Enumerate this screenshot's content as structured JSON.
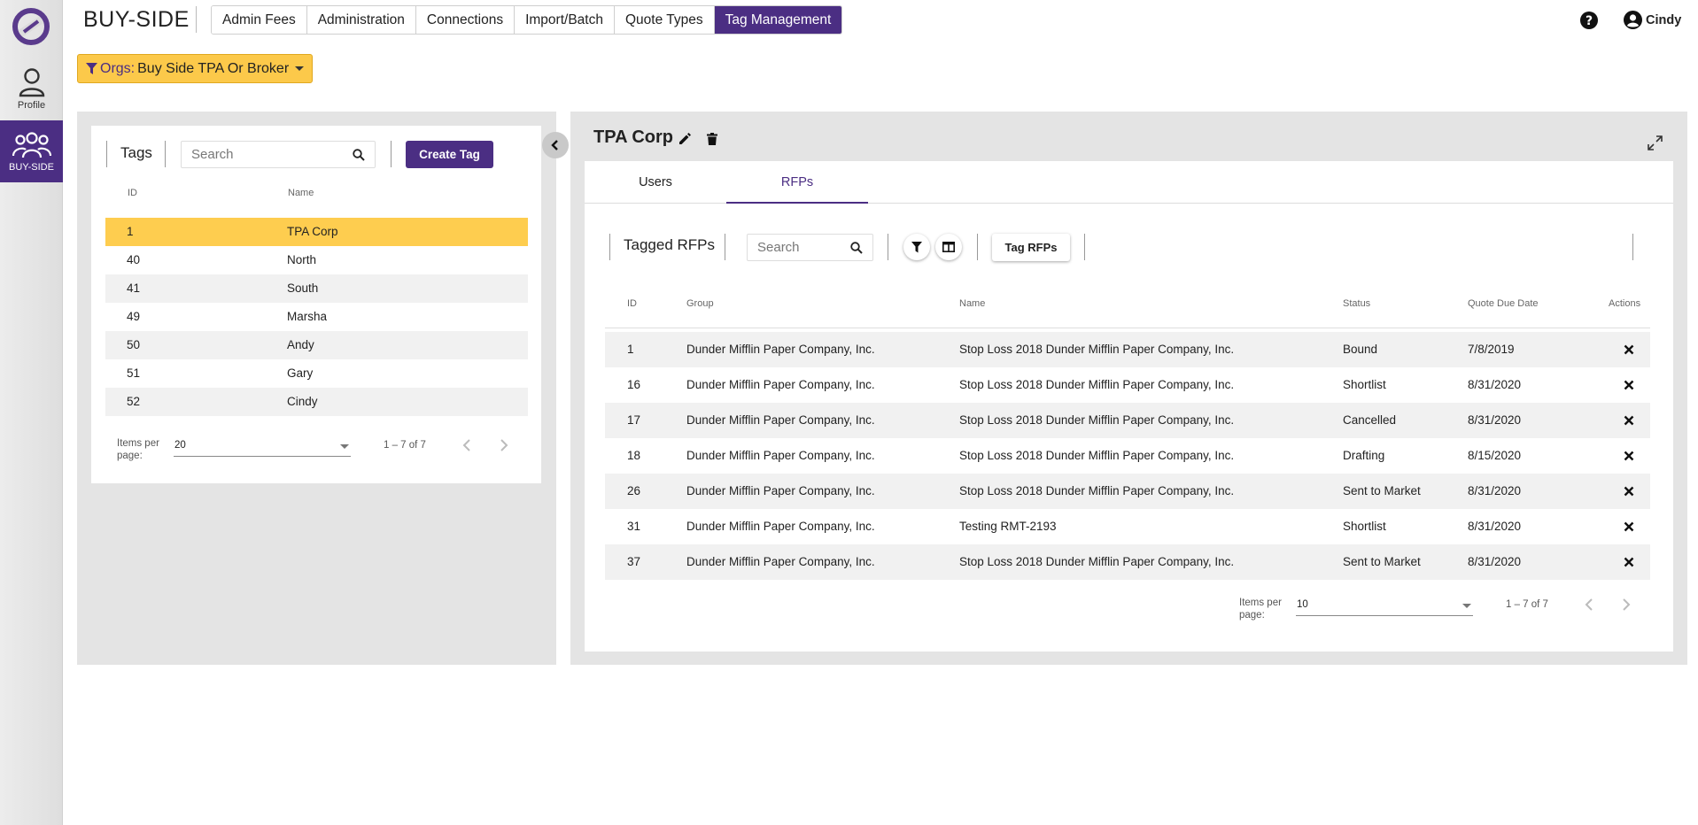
{
  "app": {
    "title": "BUY-SIDE"
  },
  "rail": {
    "profile_label": "Profile",
    "buyside_label": "BUY-SIDE"
  },
  "nav": {
    "tabs": [
      {
        "label": "Admin Fees",
        "active": false
      },
      {
        "label": "Administration",
        "active": false
      },
      {
        "label": "Connections",
        "active": false
      },
      {
        "label": "Import/Batch",
        "active": false
      },
      {
        "label": "Quote Types",
        "active": false
      },
      {
        "label": "Tag Management",
        "active": true
      }
    ]
  },
  "user": {
    "name": "Cindy"
  },
  "org_filter": {
    "prefix": "Orgs:",
    "value": "Buy Side TPA Or Broker"
  },
  "tags_panel": {
    "title": "Tags",
    "search_placeholder": "Search",
    "create_label": "Create Tag",
    "columns": {
      "id": "ID",
      "name": "Name"
    },
    "rows": [
      {
        "id": "1",
        "name": "TPA Corp"
      },
      {
        "id": "40",
        "name": "North"
      },
      {
        "id": "41",
        "name": "South"
      },
      {
        "id": "49",
        "name": "Marsha"
      },
      {
        "id": "50",
        "name": "Andy"
      },
      {
        "id": "51",
        "name": "Gary"
      },
      {
        "id": "52",
        "name": "Cindy"
      }
    ],
    "selected_index": 0,
    "pager": {
      "items_per_page_label": "Items per page:",
      "page_size": "20",
      "range": "1 – 7 of 7"
    }
  },
  "detail": {
    "title": "TPA Corp",
    "tabs": [
      {
        "label": "Users",
        "active": false
      },
      {
        "label": "RFPs",
        "active": true
      }
    ],
    "tagged_title": "Tagged RFPs",
    "search_placeholder": "Search",
    "tag_button_label": "Tag RFPs",
    "columns": {
      "id": "ID",
      "group": "Group",
      "name": "Name",
      "status": "Status",
      "due": "Quote Due Date",
      "actions": "Actions"
    },
    "rows": [
      {
        "id": "1",
        "group": "Dunder Mifflin Paper Company, Inc.",
        "name": "Stop Loss 2018 Dunder Mifflin Paper Company, Inc.",
        "status": "Bound",
        "due": "7/8/2019"
      },
      {
        "id": "16",
        "group": "Dunder Mifflin Paper Company, Inc.",
        "name": "Stop Loss 2018 Dunder Mifflin Paper Company, Inc.",
        "status": "Shortlist",
        "due": "8/31/2020"
      },
      {
        "id": "17",
        "group": "Dunder Mifflin Paper Company, Inc.",
        "name": "Stop Loss 2018 Dunder Mifflin Paper Company, Inc.",
        "status": "Cancelled",
        "due": "8/31/2020"
      },
      {
        "id": "18",
        "group": "Dunder Mifflin Paper Company, Inc.",
        "name": "Stop Loss 2018 Dunder Mifflin Paper Company, Inc.",
        "status": "Drafting",
        "due": "8/15/2020"
      },
      {
        "id": "26",
        "group": "Dunder Mifflin Paper Company, Inc.",
        "name": "Stop Loss 2018 Dunder Mifflin Paper Company, Inc.",
        "status": "Sent to Market",
        "due": "8/31/2020"
      },
      {
        "id": "31",
        "group": "Dunder Mifflin Paper Company, Inc.",
        "name": "Testing RMT-2193",
        "status": "Shortlist",
        "due": "8/31/2020"
      },
      {
        "id": "37",
        "group": "Dunder Mifflin Paper Company, Inc.",
        "name": "Stop Loss 2018 Dunder Mifflin Paper Company, Inc.",
        "status": "Sent to Market",
        "due": "8/31/2020"
      }
    ],
    "pager": {
      "items_per_page_label": "Items per page:",
      "page_size": "10",
      "range": "1 – 7 of 7"
    }
  },
  "colors": {
    "brand": "#4b2e83",
    "highlight": "#fecd4f"
  }
}
